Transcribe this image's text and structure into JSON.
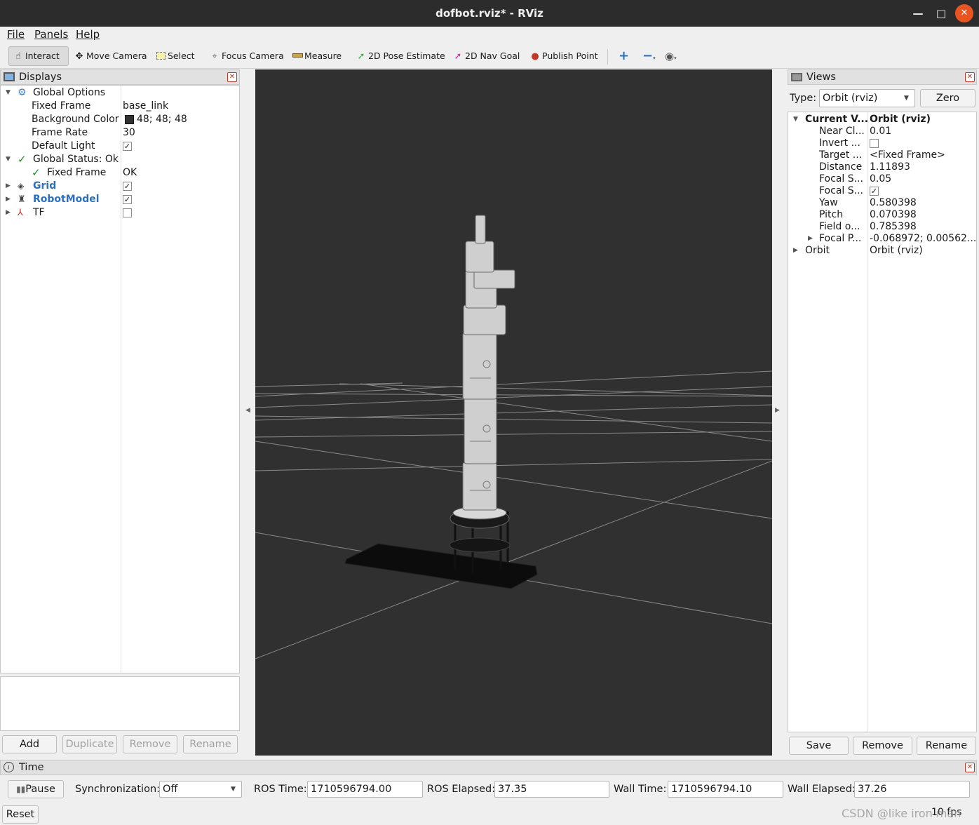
{
  "window": {
    "title": "dofbot.rviz* - RViz",
    "minimize": "—",
    "maximize": "□",
    "close": "✕"
  },
  "menu": [
    "File",
    "Panels",
    "Help"
  ],
  "toolbar": {
    "tools": [
      {
        "label": "Interact",
        "icon": "hand-icon"
      },
      {
        "label": "Move Camera",
        "icon": "move-camera-icon"
      },
      {
        "label": "Select",
        "icon": "select-icon"
      },
      {
        "label": "Focus Camera",
        "icon": "focus-icon"
      },
      {
        "label": "Measure",
        "icon": "ruler-icon"
      },
      {
        "label": "2D Pose Estimate",
        "icon": "green-arrow-icon"
      },
      {
        "label": "2D Nav Goal",
        "icon": "pink-arrow-icon"
      },
      {
        "label": "Publish Point",
        "icon": "map-pin-icon"
      }
    ],
    "extra_icons": [
      "plus-icon",
      "minus-icon",
      "eye-icon"
    ],
    "colors": {
      "pose_estimate": "#2eb82e",
      "nav_goal": "#e020b0",
      "publish_point": "#c0392b",
      "plus": "#2d6fbf"
    }
  },
  "displays": {
    "title": "Displays",
    "rows": [
      {
        "label": "Global Options",
        "value": ""
      },
      {
        "label": "Fixed Frame",
        "value": "base_link"
      },
      {
        "label": "Background Color",
        "value": "48; 48; 48",
        "swatch": "#303030"
      },
      {
        "label": "Frame Rate",
        "value": "30"
      },
      {
        "label": "Default Light",
        "value": "✓"
      },
      {
        "label": "Global Status: Ok",
        "value": ""
      },
      {
        "label": "Fixed Frame",
        "value": "OK"
      },
      {
        "label": "Grid",
        "value": "✓"
      },
      {
        "label": "RobotModel",
        "value": "✓"
      },
      {
        "label": "TF",
        "value": ""
      }
    ],
    "buttons": {
      "add": "Add",
      "duplicate": "Duplicate",
      "remove": "Remove",
      "rename": "Rename"
    }
  },
  "views": {
    "title": "Views",
    "type_label": "Type:",
    "type_value": "Orbit (rviz)",
    "zero": "Zero",
    "rows": [
      {
        "label": "Current V...",
        "value": "Orbit (rviz)"
      },
      {
        "label": "Near Cl...",
        "value": "0.01"
      },
      {
        "label": "Invert ...",
        "value": ""
      },
      {
        "label": "Target ...",
        "value": "<Fixed Frame>"
      },
      {
        "label": "Distance",
        "value": "1.11893"
      },
      {
        "label": "Focal S...",
        "value": "0.05"
      },
      {
        "label": "Focal S...",
        "value": "✓"
      },
      {
        "label": "Yaw",
        "value": "0.580398"
      },
      {
        "label": "Pitch",
        "value": "0.070398"
      },
      {
        "label": "Field o...",
        "value": "0.785398"
      },
      {
        "label": "Focal P...",
        "value": "-0.068972; 0.00562..."
      },
      {
        "label": "Orbit",
        "value": "Orbit (rviz)"
      }
    ],
    "buttons": {
      "save": "Save",
      "remove": "Remove",
      "rename": "Rename"
    }
  },
  "viewport": {
    "background": "#303030"
  },
  "time": {
    "title": "Time",
    "pause": "Pause",
    "sync_label": "Synchronization:",
    "sync_value": "Off",
    "ros_time_label": "ROS Time:",
    "ros_time": "1710596794.00",
    "ros_elapsed_label": "ROS Elapsed:",
    "ros_elapsed": "37.35",
    "wall_time_label": "Wall Time:",
    "wall_time": "1710596794.10",
    "wall_elapsed_label": "Wall Elapsed:",
    "wall_elapsed": "37.26"
  },
  "status": {
    "reset": "Reset",
    "fps": "10 fps",
    "watermark": "CSDN @like iron man"
  }
}
